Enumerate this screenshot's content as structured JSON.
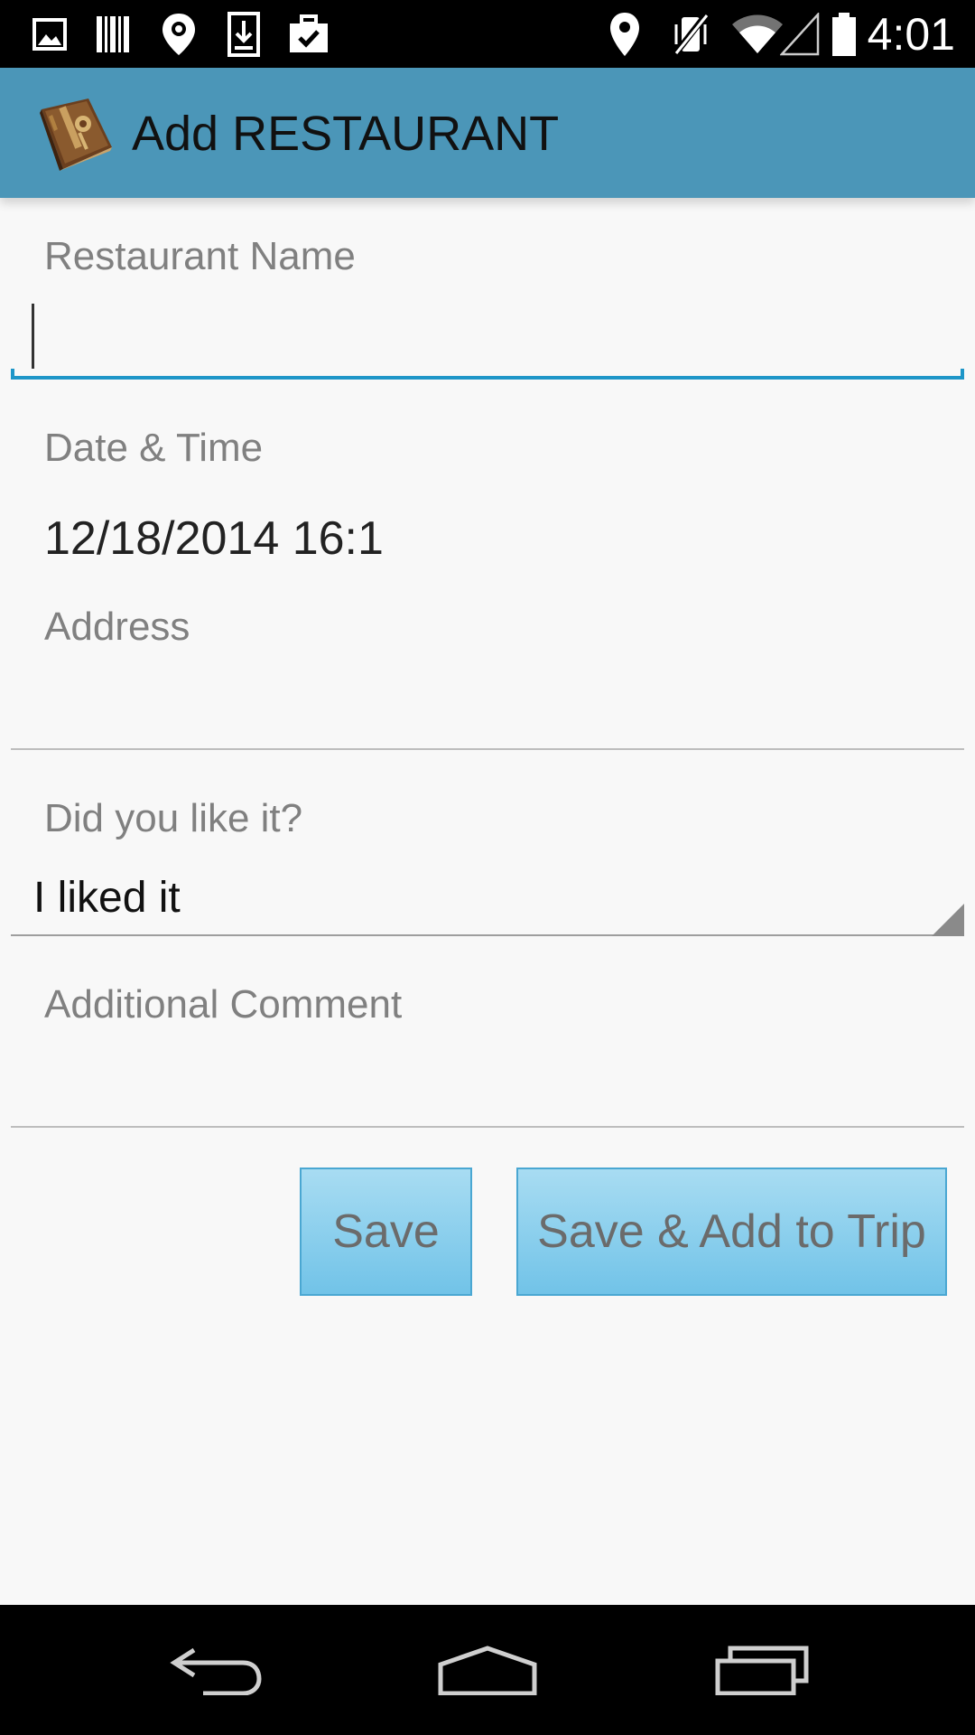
{
  "status_bar": {
    "time": "4:01",
    "left_icons": [
      "image-icon",
      "barcode-icon",
      "location-pin-icon",
      "download-icon",
      "briefcase-check-icon"
    ],
    "right_icons": [
      "location-icon",
      "vibrate-off-icon",
      "wifi-icon",
      "signal-icon",
      "battery-icon"
    ]
  },
  "action_bar": {
    "title": "Add RESTAURANT",
    "logo_icon": "journal-book-icon",
    "background_color": "#4b96b8"
  },
  "form": {
    "restaurant_name_label": "Restaurant Name",
    "restaurant_name_value": "",
    "date_time_label": "Date & Time",
    "date_time_value": "12/18/2014 16:1",
    "address_label": "Address",
    "address_value": "",
    "liked_label": "Did you like it?",
    "liked_value": "I liked it",
    "comment_label": "Additional Comment",
    "comment_value": "",
    "focus_color": "#1e96c8"
  },
  "buttons": {
    "save_label": "Save",
    "save_trip_label": "Save & Add to Trip"
  },
  "nav_bar": {
    "back_icon": "back-icon",
    "home_icon": "home-icon",
    "recents_icon": "recents-icon"
  }
}
